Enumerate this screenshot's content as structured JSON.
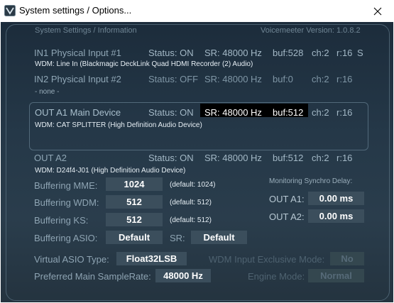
{
  "window": {
    "title": "System settings / Options..."
  },
  "header": {
    "left": "System Settings / Information",
    "version": "Voicemeeter Version: 1.0.8.2"
  },
  "inputs": [
    {
      "name": "IN1 Physical Input #1",
      "status": "Status: ON",
      "sr": "SR: 48000 Hz",
      "buf": "buf:528",
      "ch": "ch:2",
      "r": "r:16",
      "extra": "S",
      "device": "WDM: Line In (Blackmagic DeckLink Quad HDMI Recorder (2) Audio)"
    },
    {
      "name": "IN2 Physical Input #2",
      "status": "Status: OFF",
      "sr": "SR: 48000 Hz",
      "buf": "buf:0",
      "ch": "ch:2",
      "r": "r:16",
      "device": "- none -"
    }
  ],
  "outputs": [
    {
      "name": "OUT A1 Main Device",
      "status": "Status: ON",
      "sr": "SR: 48000 Hz",
      "buf": "buf:512",
      "ch": "ch:2",
      "r": "r:16",
      "device": "WDM: CAT SPLITTER (High Definition Audio Device)"
    },
    {
      "name": "OUT A2",
      "status": "Status: ON",
      "sr": "SR: 48000 Hz",
      "buf": "buf:512",
      "ch": "ch:2",
      "r": "r:16",
      "device": "WDM: D24f4-J01 (High Definition Audio Device)"
    }
  ],
  "buffering": {
    "mme": {
      "label": "Buffering MME:",
      "value": "1024",
      "default": "(default: 1024)"
    },
    "wdm": {
      "label": "Buffering WDM:",
      "value": "512",
      "default": "(default: 512)"
    },
    "ks": {
      "label": "Buffering KS:",
      "value": "512",
      "default": "(default: 512)"
    },
    "asio": {
      "label": "Buffering ASIO:",
      "value": "Default",
      "sr_label": "SR:",
      "sr_value": "Default"
    }
  },
  "sync": {
    "title": "Monitoring Synchro Delay:",
    "a1_label": "OUT A1:",
    "a1_value": "0.00 ms",
    "a2_label": "OUT A2:",
    "a2_value": "0.00 ms"
  },
  "asio_type": {
    "label": "Virtual ASIO Type:",
    "value": "Float32LSB"
  },
  "samplerate": {
    "label": "Preferred Main SampleRate:",
    "value": "48000 Hz"
  },
  "wdm_exclusive": {
    "label": "WDM Input Exclusive Mode:",
    "value": "No"
  },
  "engine_mode": {
    "label": "Engine Mode:",
    "value": "Normal"
  }
}
